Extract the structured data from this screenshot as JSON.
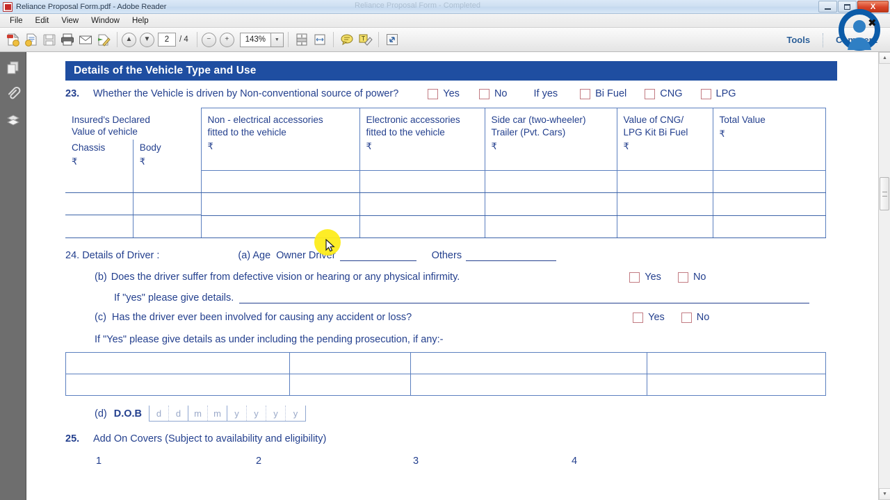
{
  "window": {
    "title": "Reliance Proposal Form.pdf - Adobe Reader",
    "ghost_title": "Reliance Proposal Form - Completed",
    "app_icon": "pdf-document-icon",
    "minimize_label": "Minimize",
    "maximize_label": "Restore",
    "close_label": "X"
  },
  "menu": {
    "items": [
      {
        "label": "File"
      },
      {
        "label": "Edit"
      },
      {
        "label": "View"
      },
      {
        "label": "Window"
      },
      {
        "label": "Help"
      }
    ]
  },
  "toolbar": {
    "tools": [
      {
        "name": "create-pdf-icon",
        "glyph": "⎘"
      },
      {
        "name": "export-pdf-icon",
        "glyph": "⎘"
      },
      {
        "name": "save-icon",
        "glyph": "💾"
      },
      {
        "name": "print-icon",
        "glyph": "⎙"
      },
      {
        "name": "email-icon",
        "glyph": "✉"
      },
      {
        "name": "send-file-icon",
        "glyph": "✎"
      }
    ],
    "previous_page_glyph": "▲",
    "next_page_glyph": "▼",
    "page_number": "2",
    "page_total": "/ 4",
    "zoom_out_glyph": "−",
    "zoom_in_glyph": "+",
    "zoom_level": "143%",
    "zoom_dropdown_glyph": "▼",
    "fit_page_icon": "fit-page-icon",
    "fit_width_icon": "fit-width-icon",
    "comment_bubble_icon": "comment-bubble-icon",
    "text_edit_icon": "text-edit-icon",
    "read_mode_icon": "read-mode-icon",
    "tools_label": "Tools",
    "comment_label": "Comment"
  },
  "left_rail": {
    "items": [
      {
        "name": "page-thumbnails-icon",
        "label": "Page Thumbnails"
      },
      {
        "name": "attachments-icon",
        "label": "Attachments"
      },
      {
        "name": "layers-icon",
        "label": "Layers"
      }
    ]
  },
  "document": {
    "section_header": "Details of the Vehicle Type and Use",
    "q23": {
      "number": "23.",
      "text": "Whether the Vehicle is driven by Non-conventional source of power?",
      "options": [
        {
          "label": "Yes"
        },
        {
          "label": "No"
        }
      ],
      "if_yes": "If yes",
      "fuel_options": [
        {
          "label": "Bi Fuel"
        },
        {
          "label": "CNG"
        },
        {
          "label": "LPG"
        }
      ]
    },
    "value_table": {
      "headers": {
        "idv_title_line1": "Insured's Declared",
        "idv_title_line2": "Value of vehicle",
        "idv_chassis": "Chassis",
        "idv_body": "Body",
        "rupee": "₹",
        "non_electrical_line1": "Non - electrical accessories",
        "non_electrical_line2": "fitted to the vehicle",
        "electronic_line1": "Electronic accessories",
        "electronic_line2": "fitted to the vehicle",
        "sidecar_line1": "Side car (two-wheeler)",
        "sidecar_line2": "Trailer (Pvt. Cars)",
        "cng_line1": "Value of CNG/",
        "cng_line2": "LPG Kit Bi Fuel",
        "total_value": "Total Value"
      },
      "row_count": 3,
      "cell_value": ""
    },
    "q24": {
      "number": "24.",
      "title": "Details of Driver :",
      "a_label": "(a) Age",
      "owner_driver": "Owner Driver",
      "others": "Others",
      "owner_driver_value": "",
      "others_value": "",
      "b_label": "(b)",
      "b_text": "Does the driver suffer from defective vision or hearing or any physical infirmity.",
      "b_yes": "Yes",
      "b_no": "No",
      "b_details_label": "If \"yes\" please give details.",
      "b_details_value": "",
      "c_label": "(c)",
      "c_text": "Has the driver ever been involved for causing any accident or loss?",
      "c_yes": "Yes",
      "c_no": "No",
      "c_details_label": "If \"Yes\" please give details as under including the pending prosecution, if any:-",
      "d_label": "(d)",
      "dob_label": "D.O.B",
      "dob_placeholder": [
        "d",
        "d",
        "m",
        "m",
        "y",
        "y",
        "y",
        "y"
      ]
    },
    "q25": {
      "number": "25.",
      "text": "Add On Covers (Subject to availability and eligibility)",
      "items": [
        "1",
        "2",
        "3",
        "4"
      ]
    }
  },
  "scrollbar": {
    "up_glyph": "▲",
    "down_glyph": "▼"
  },
  "overlay": {
    "close_overlay_glyph": "✖",
    "webcam_icon": "user-avatar-icon",
    "cursor_icon": "mouse-cursor-icon",
    "click_highlight": "click-highlight"
  },
  "colors": {
    "form_blue": "#24408e",
    "header_blue": "#1f4ea1",
    "checkbox_border": "#c27b82",
    "accent_ring": "#0b5ba8",
    "highlight_yellow": "#fdec1b"
  }
}
